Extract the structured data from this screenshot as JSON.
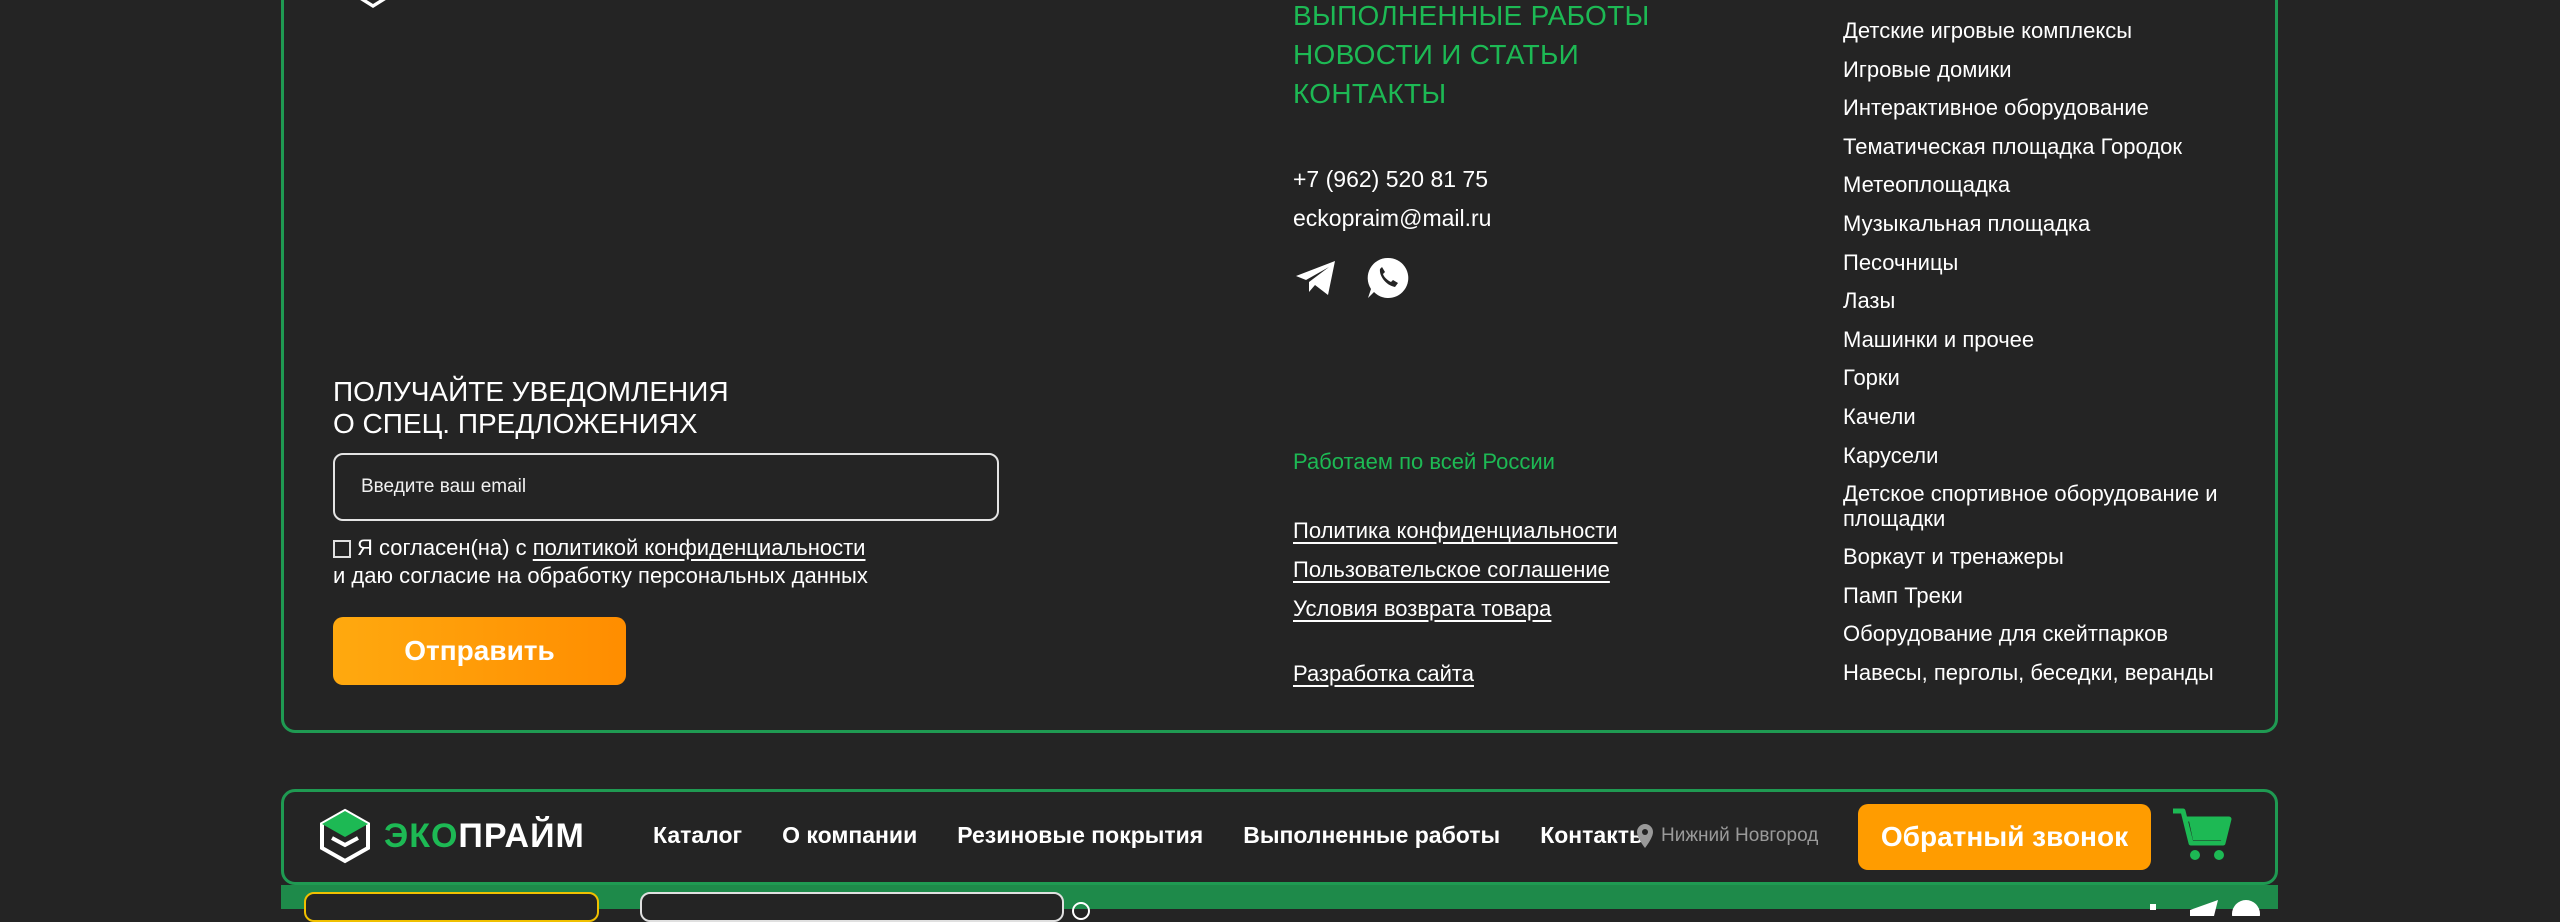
{
  "footer": {
    "nav": [
      "ВЫПОЛНЕННЫЕ РАБОТЫ",
      "НОВОСТИ И СТАТЬИ",
      "КОНТАКТЫ"
    ],
    "phone": "+7 (962) 520 81 75",
    "email": "eckopraim@mail.ru",
    "social_icons": [
      "telegram-icon",
      "whatsapp-icon"
    ],
    "region": "Работаем по всей России",
    "legal": [
      "Политика конфиденциальности",
      "Пользовательское соглашение",
      "Условия возврата товара"
    ],
    "dev_link": "Разработка сайта",
    "catalog": [
      "Детские игровые комплексы",
      "Игровые домики",
      "Интерактивное оборудование",
      "Тематическая площадка Городок",
      "Метеоплощадка",
      "Музыкальная площадка",
      "Песочницы",
      "Лазы",
      "Машинки и прочее",
      "Горки",
      "Качели",
      "Карусели",
      "Детское спортивное оборудование и площадки",
      "Воркаут и тренажеры",
      "Памп Треки",
      "Оборудование для скейтпарков",
      "Навесы, перголы, беседки, веранды"
    ],
    "subscribe": {
      "title_line1": "ПОЛУЧАЙТЕ УВЕДОМЛЕНИЯ",
      "title_line2": "О СПЕЦ. ПРЕДЛОЖЕНИЯХ",
      "email_placeholder": "Введите ваш email",
      "consent_prefix": "Я согласен(на) с",
      "consent_link": "политикой конфиденциальности",
      "consent_suffix": "и даю согласие на обработку персональных данных",
      "submit_label": "Отправить"
    }
  },
  "header": {
    "brand_eco": "ЭКО",
    "brand_rest": "ПРАЙМ",
    "menu": [
      "Каталог",
      "О компании",
      "Резиновые покрытия",
      "Выполненные работы",
      "Контакты"
    ],
    "city": "Нижний Новгород",
    "callback_label": "Обратный звонок",
    "icons": [
      "map-pin-icon",
      "cart-icon"
    ]
  },
  "colors": {
    "accent_green": "#1db954",
    "border_green": "#1f9a52",
    "accent_orange": "#ff9c00",
    "background": "#242424"
  }
}
